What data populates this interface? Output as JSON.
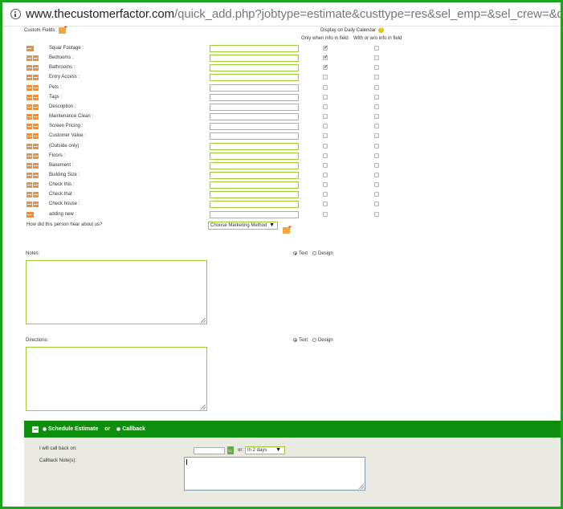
{
  "browser": {
    "url_host": "www.thecustomerfactor.com",
    "url_path": "/quick_add.php?jobtype=estimate&custtype=res&sel_emp=&sel_crew=&qreferer=prospects_c"
  },
  "custom_fields": {
    "label": "Custom Fields:",
    "display_header": "Display on Daily Calendar",
    "col_only": "Only when info in field",
    "col_with": "With or w/o info in field",
    "rows": [
      {
        "label": "Squar Footage :",
        "only": true,
        "with": false,
        "single": true
      },
      {
        "label": "Bedrooms :",
        "only": true,
        "with": false,
        "single": false
      },
      {
        "label": "Bathrooms :",
        "only": true,
        "with": false,
        "single": false
      },
      {
        "label": "Entry Access :",
        "only": false,
        "with": false,
        "single": false
      },
      {
        "label": "Pets :",
        "only": false,
        "with": false,
        "single": false
      },
      {
        "label": "Tags :",
        "only": false,
        "with": false,
        "single": false
      },
      {
        "label": "Description :",
        "only": false,
        "with": false,
        "single": false
      },
      {
        "label": "Maintenance Clean :",
        "only": false,
        "with": false,
        "single": false
      },
      {
        "label": "Screen Pricing :",
        "only": false,
        "with": false,
        "single": false
      },
      {
        "label": "Customer Value :",
        "only": false,
        "with": false,
        "single": false
      },
      {
        "label": "(Outside only) :",
        "only": false,
        "with": false,
        "single": false
      },
      {
        "label": "Floors :",
        "only": false,
        "with": false,
        "single": false
      },
      {
        "label": "Basement :",
        "only": false,
        "with": false,
        "single": false
      },
      {
        "label": "Building Size :",
        "only": false,
        "with": false,
        "single": false
      },
      {
        "label": "Check this :",
        "only": false,
        "with": false,
        "single": false
      },
      {
        "label": "Check that :",
        "only": false,
        "with": false,
        "single": false
      },
      {
        "label": "Check house :",
        "only": false,
        "with": false,
        "single": false
      },
      {
        "label": "adding new :",
        "only": false,
        "with": false,
        "single": true
      }
    ]
  },
  "marketing": {
    "label": "How did this person hear about us?",
    "select_value": "Choose Marketing Method"
  },
  "notes": {
    "label": "Notes:",
    "mode_text": "Text",
    "mode_design": "Design"
  },
  "directions": {
    "label": "Directions:",
    "mode_text": "Text",
    "mode_design": "Design"
  },
  "schedule": {
    "option_estimate": "Schedule Estimate",
    "or": "or",
    "option_callback": "Callback",
    "call_back_label": "I will call back on:",
    "or_in": "or:",
    "days_value": "In 2 days",
    "note_label": "Callback Note(s):"
  }
}
